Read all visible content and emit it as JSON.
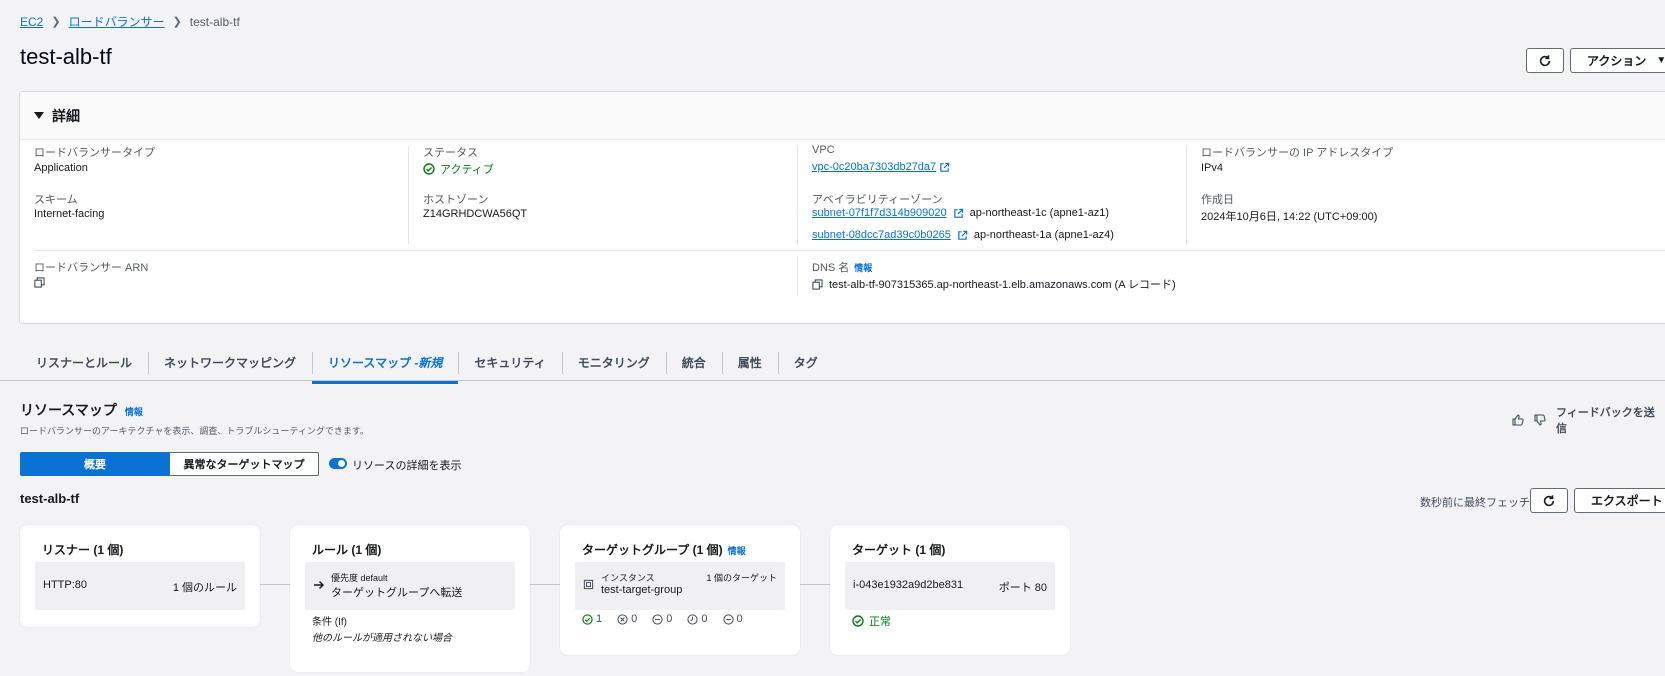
{
  "breadcrumb": {
    "ec2": "EC2",
    "lb": "ロードバランサー",
    "current": "test-alb-tf"
  },
  "page_title": "test-alb-tf",
  "actions_label": "アクション",
  "details": {
    "title": "詳細",
    "lb_type_label": "ロードバランサータイプ",
    "lb_type_value": "Application",
    "status_label": "ステータス",
    "status_value": "アクティブ",
    "vpc_label": "VPC",
    "vpc_value": "vpc-0c20ba7303db27da7",
    "ip_type_label": "ロードバランサーの IP アドレスタイプ",
    "ip_type_value": "IPv4",
    "scheme_label": "スキーム",
    "scheme_value": "Internet-facing",
    "hosted_zone_label": "ホストゾーン",
    "hosted_zone_value": "Z14GRHDCWA56QT",
    "az_label": "アベイラビリティーゾーン",
    "az": [
      {
        "subnet": "subnet-07f1f7d314b909020",
        "zone": "ap-northeast-1c (apne1-az1)"
      },
      {
        "subnet": "subnet-08dcc7ad39c0b0265",
        "zone": "ap-northeast-1a (apne1-az4)"
      }
    ],
    "created_label": "作成日",
    "created_value": "2024年10月6日, 14:22 (UTC+09:00)",
    "arn_label": "ロードバランサー ARN",
    "dns_label": "DNS 名",
    "dns_info": "情報",
    "dns_value": "test-alb-tf-907315365.ap-northeast-1.elb.amazonaws.com (A レコード)"
  },
  "tabs": [
    {
      "label": "リスナーとルール"
    },
    {
      "label": "ネットワークマッピング"
    },
    {
      "label": "リソースマップ - ",
      "suffix": "新規",
      "active": true
    },
    {
      "label": "セキュリティ"
    },
    {
      "label": "モニタリング"
    },
    {
      "label": "統合"
    },
    {
      "label": "属性"
    },
    {
      "label": "タグ"
    }
  ],
  "resource_map": {
    "title": "リソースマップ",
    "info": "情報",
    "description": "ロードバランサーのアーキテクチャを表示、調査、トラブルシューティングできます。",
    "feedback": "フィードバックを送信",
    "seg_overview": "概要",
    "seg_unhealthy": "異常なターゲットマップ",
    "toggle_label": "リソースの詳細を表示",
    "name": "test-alb-tf",
    "fetched": "数秒前に最終フェッチ",
    "export": "エクスポート",
    "listener": {
      "title": "リスナー (1 個)",
      "protocol": "HTTP:80",
      "rules": "1 個のルール"
    },
    "rules": {
      "title": "ルール (1 個)",
      "priority": "優先度 default",
      "action": "ターゲットグループへ転送",
      "cond_label": "条件 (If)",
      "cond_value": "他のルールが適用されない場合"
    },
    "target_group": {
      "title": "ターゲットグループ (1 個)",
      "info": "情報",
      "type": "インスタンス",
      "name": "test-target-group",
      "count": "1 個のターゲット",
      "stats": [
        "1",
        "0",
        "0",
        "0",
        "0"
      ]
    },
    "targets": {
      "title": "ターゲット (1 個)",
      "id": "i-043e1932a9d2be831",
      "port": "ポート 80",
      "health": "正常"
    }
  }
}
